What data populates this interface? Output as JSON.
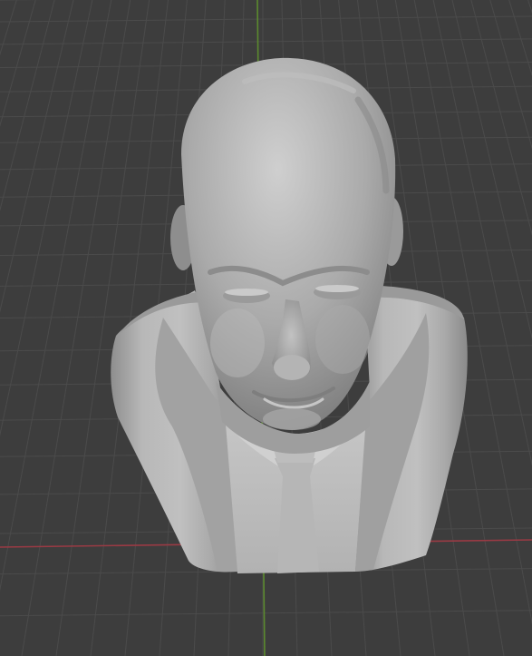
{
  "viewport": {
    "background_color": "#3d3d3d",
    "grid_color": "#4b4b4b",
    "x_axis_color": "#9a3a44",
    "y_axis_color": "#5b8a2e"
  },
  "model": {
    "icon": "mesh-bust-icon",
    "base_color": "#a8a8a8",
    "highlight_color": "#c4c4c4",
    "shadow_color": "#6e6e6e"
  }
}
